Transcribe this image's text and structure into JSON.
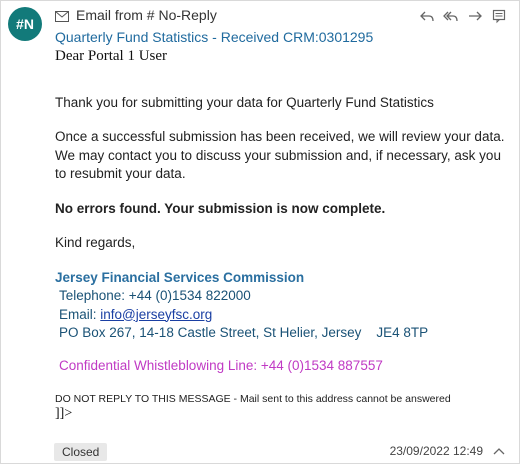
{
  "avatar": {
    "initials": "#N",
    "color": "#127a7a"
  },
  "header": {
    "email_icon": "email-icon",
    "sender_line": "Email from # No-Reply",
    "subject_line": "Quarterly Fund Statistics - Received CRM:0301295",
    "actions": [
      "reply-icon",
      "reply-all-icon",
      "forward-icon",
      "view-details-icon"
    ]
  },
  "body": {
    "greeting": "Dear Portal 1 User",
    "p1": "Thank you for submitting your data for Quarterly Fund Statistics",
    "p2": "Once a successful submission has been received, we will review your data. We may contact you to discuss your submission and, if necessary, ask you to resubmit your data.",
    "p3": "No errors found. Your submission is now complete.",
    "closing": "Kind regards,",
    "org": "Jersey Financial Services Commission",
    "telephone": "Telephone: +44 (0)1534 822000",
    "email_label": "Email: ",
    "email_link": "info@jerseyfsc.org",
    "address": "PO Box 267, 14-18 Castle Street, St Helier, Jersey    JE4 8TP",
    "whistleblowing": "Confidential Whistleblowing Line: +44 (0)1534 887557",
    "noreply": "DO NOT REPLY TO THIS MESSAGE - Mail sent to this address cannot be answered",
    "trailer": "]]>"
  },
  "footer": {
    "status": "Closed",
    "timestamp": "23/09/2022 12:49",
    "collapse_icon": "chevron-up-icon"
  },
  "colors": {
    "subject": "#1f6a9e",
    "org": "#2a6fa0",
    "whistle": "#c03ac4",
    "link": "#1a3fa3"
  }
}
